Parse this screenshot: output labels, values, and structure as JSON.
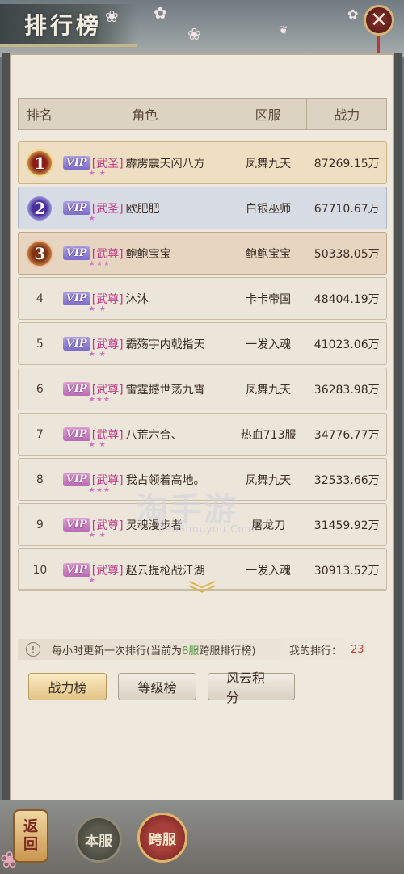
{
  "header": {
    "title": "排行榜",
    "close_icon": "close-icon"
  },
  "table": {
    "headers": {
      "rank": "排名",
      "role": "角色",
      "server": "区服",
      "power": "战力"
    },
    "rows": [
      {
        "rank": "1",
        "vip": "VIP",
        "title": "[武圣]",
        "stars": "★ ★",
        "name": "霹雳震天闪八方",
        "server": "凤舞九天",
        "power": "87269.15万"
      },
      {
        "rank": "2",
        "vip": "VIP",
        "title": "[武圣]",
        "stars": "★",
        "name": "欧肥肥",
        "server": "白银巫师",
        "power": "67710.67万"
      },
      {
        "rank": "3",
        "vip": "VIP",
        "title": "[武尊]",
        "stars": "★★★",
        "name": "鲍鲍宝宝",
        "server": "鲍鲍宝宝",
        "power": "50338.05万"
      },
      {
        "rank": "4",
        "vip": "VIP",
        "title": "[武尊]",
        "stars": "★ ★",
        "name": "沐沐",
        "server": "卡卡帝国",
        "power": "48404.19万"
      },
      {
        "rank": "5",
        "vip": "VIP",
        "title": "[武尊]",
        "stars": "★ ★",
        "name": "霸殇宇内戟指天",
        "server": "一发入魂",
        "power": "41023.06万"
      },
      {
        "rank": "6",
        "vip": "VIP",
        "title": "[武尊]",
        "stars": "★★★",
        "name": "雷霆撼世荡九霄",
        "server": "凤舞九天",
        "power": "36283.98万"
      },
      {
        "rank": "7",
        "vip": "VIP",
        "title": "[武尊]",
        "stars": "★ ★",
        "name": "八荒六合、",
        "server": "热血713服",
        "power": "34776.77万"
      },
      {
        "rank": "8",
        "vip": "VIP",
        "title": "[武尊]",
        "stars": "★★★",
        "name": "我占领着高地。",
        "server": "凤舞九天",
        "power": "32533.66万"
      },
      {
        "rank": "9",
        "vip": "VIP",
        "title": "[武尊]",
        "stars": "★ ★",
        "name": "灵魂漫步者",
        "server": "屠龙刀",
        "power": "31459.92万"
      },
      {
        "rank": "10",
        "vip": "VIP",
        "title": "[武尊]",
        "stars": "★",
        "name": "赵云提枪战江湖",
        "server": "一发入魂",
        "power": "30913.52万"
      }
    ]
  },
  "watermark": {
    "main": "淘手游",
    "sub": "TaoShouyou.Com"
  },
  "info": {
    "text_before": "每小时更新一次排行(当前为",
    "highlight": "8服",
    "text_after": "跨服排行榜)",
    "my_rank_label": "我的排行：",
    "my_rank_value": "23"
  },
  "tabs": [
    {
      "label": "战力榜",
      "active": true
    },
    {
      "label": "等级榜",
      "active": false
    },
    {
      "label": "风云积分",
      "active": false
    }
  ],
  "bottom": {
    "back_label_1": "返",
    "back_label_2": "回",
    "local_server": "本服",
    "cross_server": "跨服"
  },
  "colors": {
    "gold_row": "#eedfc2",
    "silver_row": "#d7dbe4",
    "bronze_row": "#e6d5c1",
    "accent_red": "#d2403a",
    "highlight_green": "#4d9c3c"
  }
}
